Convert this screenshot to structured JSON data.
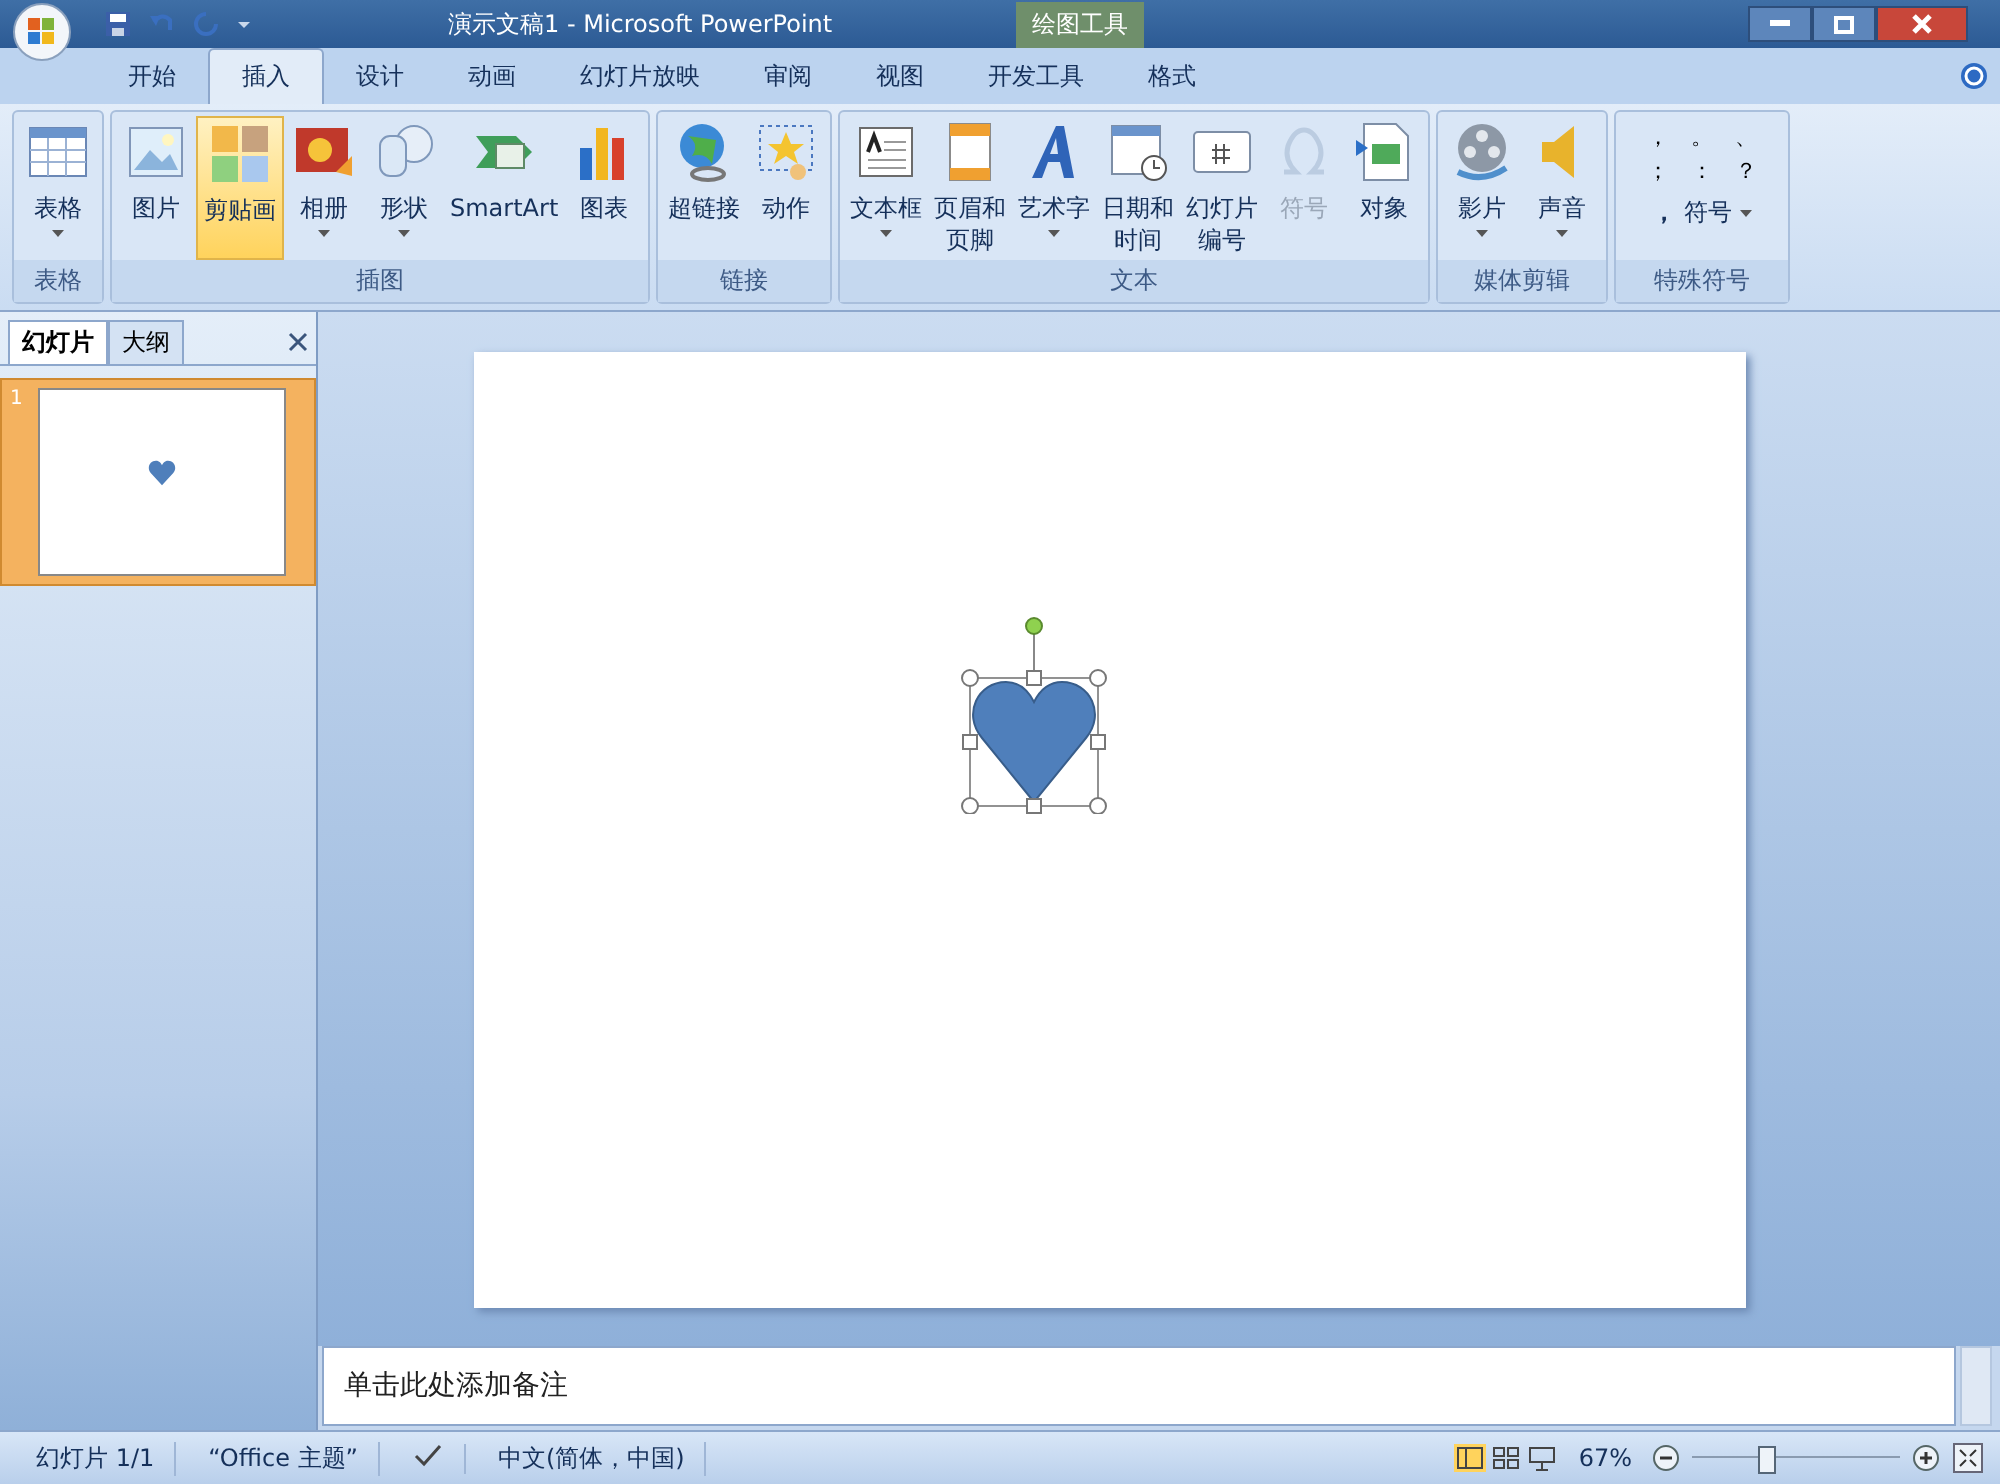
{
  "window": {
    "title": "演示文稿1 - Microsoft PowerPoint",
    "context_tab": "绘图工具"
  },
  "tabs": [
    {
      "label": "开始",
      "selected": false
    },
    {
      "label": "插入",
      "selected": true
    },
    {
      "label": "设计",
      "selected": false
    },
    {
      "label": "动画",
      "selected": false
    },
    {
      "label": "幻灯片放映",
      "selected": false
    },
    {
      "label": "审阅",
      "selected": false
    },
    {
      "label": "视图",
      "selected": false
    },
    {
      "label": "开发工具",
      "selected": false
    },
    {
      "label": "格式",
      "selected": false
    }
  ],
  "ribbon_groups": [
    {
      "name": "表格",
      "buttons": [
        {
          "label": "表格",
          "dropdown": true,
          "disabled": false,
          "selected": false
        }
      ]
    },
    {
      "name": "插图",
      "buttons": [
        {
          "label": "图片",
          "dropdown": false,
          "disabled": false,
          "selected": false
        },
        {
          "label": "剪贴画",
          "dropdown": false,
          "disabled": false,
          "selected": true
        },
        {
          "label": "相册",
          "dropdown": true,
          "disabled": false,
          "selected": false
        },
        {
          "label": "形状",
          "dropdown": true,
          "disabled": false,
          "selected": false
        },
        {
          "label": "SmartArt",
          "dropdown": false,
          "disabled": false,
          "selected": false
        },
        {
          "label": "图表",
          "dropdown": false,
          "disabled": false,
          "selected": false
        }
      ]
    },
    {
      "name": "链接",
      "buttons": [
        {
          "label": "超链接",
          "dropdown": false,
          "disabled": false,
          "selected": false
        },
        {
          "label": "动作",
          "dropdown": false,
          "disabled": false,
          "selected": false
        }
      ]
    },
    {
      "name": "文本",
      "buttons": [
        {
          "label": "文本框",
          "dropdown": true,
          "disabled": false,
          "selected": false
        },
        {
          "label": "页眉和页脚",
          "wrap": true,
          "dropdown": false,
          "disabled": false,
          "selected": false
        },
        {
          "label": "艺术字",
          "dropdown": true,
          "disabled": false,
          "selected": false
        },
        {
          "label": "日期和时间",
          "wrap": true,
          "dropdown": false,
          "disabled": false,
          "selected": false
        },
        {
          "label": "幻灯片编号",
          "wrap": true,
          "dropdown": false,
          "disabled": false,
          "selected": false
        },
        {
          "label": "符号",
          "dropdown": false,
          "disabled": true,
          "selected": false
        },
        {
          "label": "对象",
          "dropdown": false,
          "disabled": false,
          "selected": false
        }
      ]
    },
    {
      "name": "媒体剪辑",
      "buttons": [
        {
          "label": "影片",
          "dropdown": true,
          "disabled": false,
          "selected": false
        },
        {
          "label": "声音",
          "dropdown": true,
          "disabled": false,
          "selected": false
        }
      ]
    }
  ],
  "special_symbols": {
    "name": "特殊符号",
    "symbols": [
      "，",
      "。",
      "、",
      "；",
      "：",
      "？"
    ],
    "symbol_button": {
      "mark": "，",
      "label": "符号"
    }
  },
  "panel_tabs": [
    {
      "label": "幻灯片",
      "selected": true
    },
    {
      "label": "大纲",
      "selected": false
    }
  ],
  "slides": [
    {
      "number": "1",
      "selected": true
    }
  ],
  "notes": {
    "placeholder": "单击此处添加备注"
  },
  "status_bar": {
    "slide": "幻灯片 1/1",
    "theme": "“Office 主题”",
    "language": "中文(简体，中国)",
    "zoom": "67%"
  },
  "zoom_slider": {
    "level": 0.35
  }
}
